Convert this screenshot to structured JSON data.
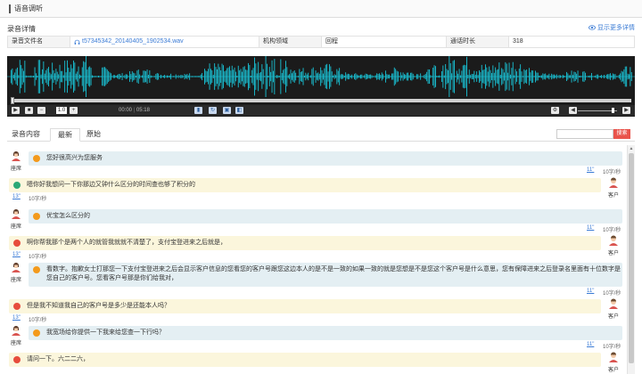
{
  "header": {
    "title": "语音调听"
  },
  "details": {
    "section_title": "录音详情",
    "more_link": "显示更多详情",
    "file_label": "录音文件名",
    "file_name": "t57345342_20140405_1902534.wav",
    "org_label": "机构领域",
    "org_value": "回程",
    "duration_label": "通话时长",
    "duration_value": "318"
  },
  "player": {
    "rate": "1.0",
    "current_time": "00:00",
    "total_time": "05:18",
    "colors": {
      "wave": "#19c3d6",
      "background": "#1b1b1b"
    }
  },
  "tabs": [
    {
      "label": "录音内容",
      "active": false
    },
    {
      "label": "最新",
      "active": true
    },
    {
      "label": "原始",
      "active": false
    }
  ],
  "search": {
    "placeholder": "",
    "button_label": "搜索"
  },
  "roles": {
    "agent": "座席",
    "customer": "客户"
  },
  "messages": [
    {
      "speaker": "agent",
      "emotion": "orange",
      "text": "您好很高兴为您服务",
      "duration": "11\"",
      "rate": "10字/秒"
    },
    {
      "speaker": "customer",
      "emotion": "green",
      "text": "嗯你好我想问一下你那边又钟什么区分的时间查也够了积分的",
      "duration": "13\"",
      "rate": "10字/秒"
    },
    {
      "speaker": "agent",
      "emotion": "orange",
      "text": "优宝怎么区分的",
      "duration": "11\"",
      "rate": "10字/秒"
    },
    {
      "speaker": "customer",
      "emotion": "red",
      "text": "啊你帮我那个是两个人的就管我就就不清楚了，支付宝登进来之后就是，",
      "duration": "13\"",
      "rate": "10字/秒"
    },
    {
      "speaker": "agent",
      "emotion": "orange",
      "text": "看数字。抱歉女士打那您一下支付宝登进来之后会显示客户信息的您看您的客户号跟您这边本人的是不是一致的如果一致的就是您想是不是您这个客户号是什么意思，您有保障进来之后登录名里面有十位数字是您自己的客户号。您看客户号那是你们给我对，",
      "duration": "11\"",
      "rate": "10字/秒"
    },
    {
      "speaker": "customer",
      "emotion": "red",
      "text": "但是我不知道我自己的客户号是多少是还能本人吗？",
      "duration": "13\"",
      "rate": "10字/秒"
    },
    {
      "speaker": "agent",
      "emotion": "orange",
      "text": "我宽场给你提供一下我来给您查一下行吗？",
      "duration": "11\"",
      "rate": "10字/秒"
    },
    {
      "speaker": "customer",
      "emotion": "red",
      "text": "请问一下。六二二六，",
      "duration": "",
      "rate": ""
    }
  ]
}
